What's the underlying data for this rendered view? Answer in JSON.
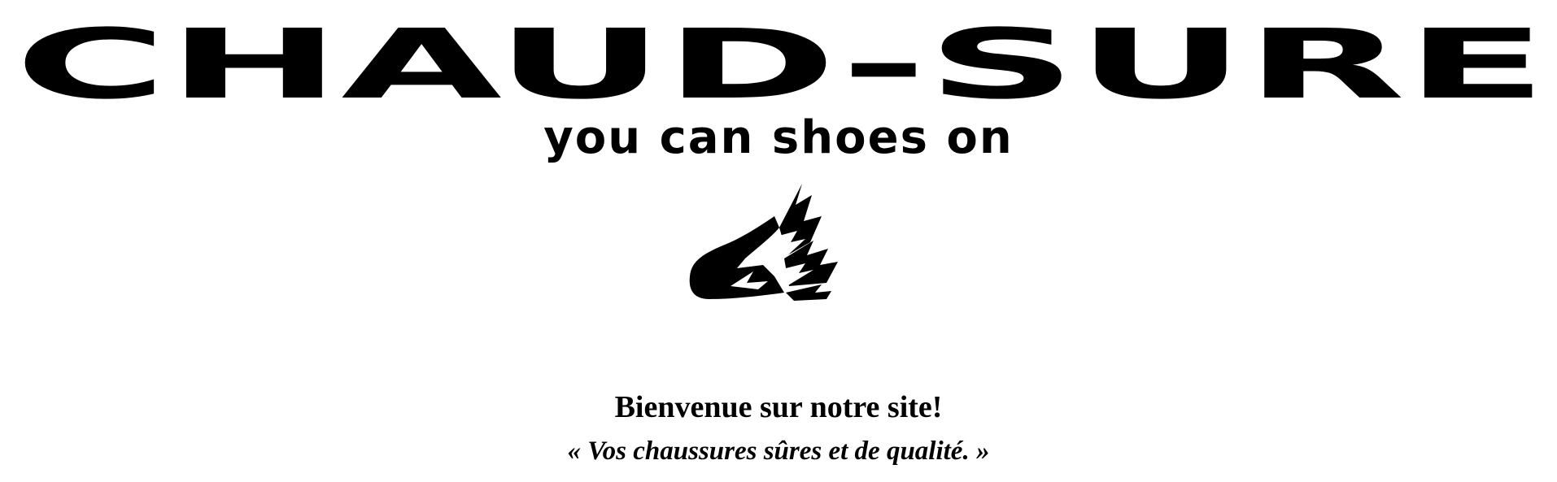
{
  "brand": {
    "name": "CHAUD-SURE",
    "tagline": "you can shoes on",
    "logo_icon": "winged-shoe-icon",
    "logo_color": "#000000"
  },
  "content": {
    "welcome": "Bienvenue sur notre site!",
    "slogan": "« Vos chaussures sûres et de qualité. »"
  },
  "colors": {
    "background": "#ffffff",
    "text": "#000000"
  }
}
